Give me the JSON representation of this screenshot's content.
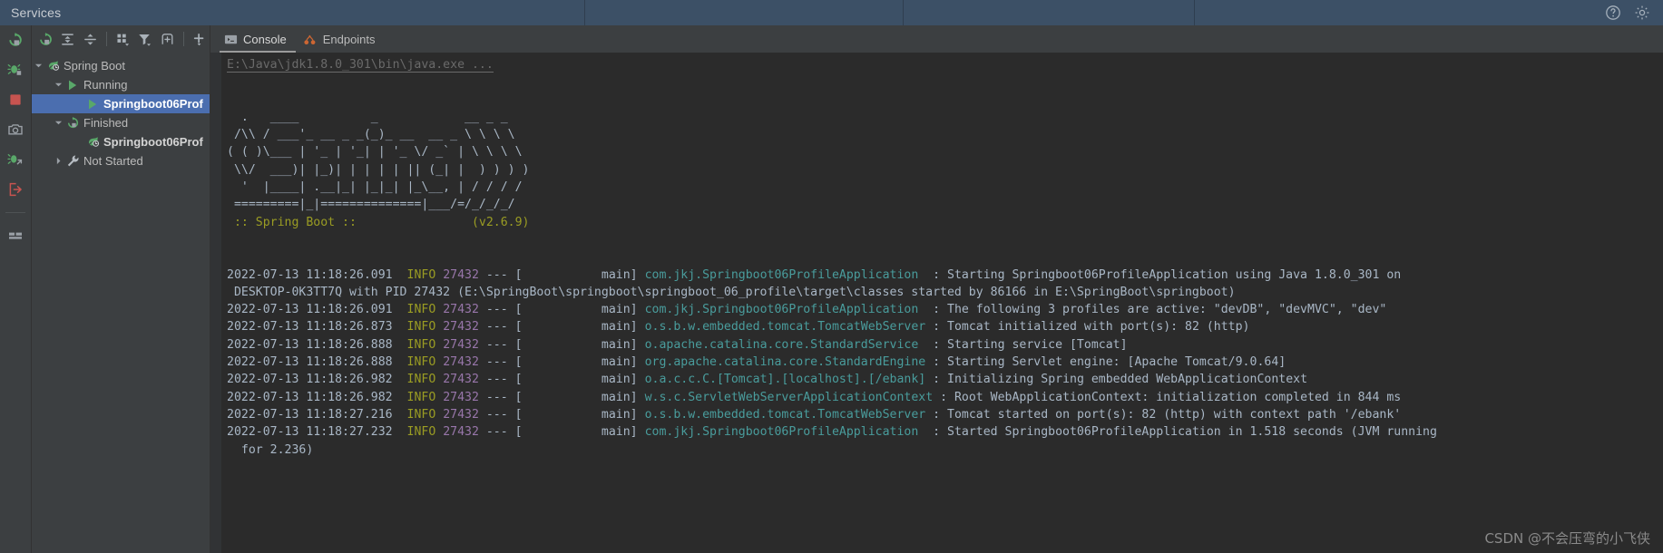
{
  "window": {
    "title": "Services",
    "right_icons": [
      {
        "name": "help-icon",
        "glyph": "?"
      },
      {
        "name": "settings-gear-icon",
        "glyph": "gear"
      }
    ]
  },
  "rail": {
    "items": [
      {
        "name": "rerun-icon",
        "tooltip": "Rerun"
      },
      {
        "name": "debug-icon",
        "tooltip": "Debug"
      },
      {
        "name": "stop-icon",
        "tooltip": "Stop"
      },
      {
        "name": "camera-icon",
        "tooltip": "Capture Memory Snapshot"
      },
      {
        "name": "debug-attach-icon",
        "tooltip": "Attach Debugger"
      },
      {
        "name": "exit-icon",
        "tooltip": "Exit"
      },
      {
        "name": "layout-icon",
        "tooltip": "Layout Settings"
      }
    ]
  },
  "services_toolbar": {
    "buttons": [
      {
        "name": "rerun-service-button",
        "tooltip": "Rerun"
      },
      {
        "name": "expand-all-button",
        "tooltip": "Expand All"
      },
      {
        "name": "collapse-all-button",
        "tooltip": "Collapse All"
      },
      {
        "name": "group-by-button",
        "tooltip": "Group By"
      },
      {
        "name": "filter-button",
        "tooltip": "Filter"
      },
      {
        "name": "show-frame-button",
        "tooltip": "Open in New Window"
      },
      {
        "name": "add-service-button",
        "tooltip": "Add Service"
      }
    ]
  },
  "services_tree": {
    "nodes": [
      {
        "label": "Spring Boot",
        "level": 0,
        "expanded": true,
        "icon": "spring-boot-icon",
        "bold": false,
        "selected": false
      },
      {
        "label": "Running",
        "level": 1,
        "expanded": true,
        "icon": "run-icon",
        "bold": false,
        "selected": false
      },
      {
        "label": "Springboot06Prof",
        "level": 2,
        "expanded": null,
        "icon": "run-icon",
        "bold": true,
        "selected": true
      },
      {
        "label": "Finished",
        "level": 1,
        "expanded": true,
        "icon": "rerun-icon",
        "bold": false,
        "selected": false
      },
      {
        "label": "Springboot06Prof",
        "level": 2,
        "expanded": null,
        "icon": "spring-boot-icon",
        "bold": true,
        "selected": false
      },
      {
        "label": "Not Started",
        "level": 1,
        "expanded": false,
        "icon": "wrench-icon",
        "bold": false,
        "selected": false
      }
    ]
  },
  "tabs": [
    {
      "label": "Console",
      "icon": "console-icon",
      "active": true
    },
    {
      "label": "Endpoints",
      "icon": "endpoints-icon",
      "active": false
    }
  ],
  "console": {
    "command_line": "E:\\Java\\jdk1.8.0_301\\bin\\java.exe ...",
    "banner_lines": [
      "  .   ____          _            __ _ _",
      " /\\\\ / ___'_ __ _ _(_)_ __  __ _ \\ \\ \\ \\",
      "( ( )\\___ | '_ | '_| | '_ \\/ _` | \\ \\ \\ \\",
      " \\\\/  ___)| |_)| | | | | || (_| |  ) ) ) )",
      "  '  |____| .__|_| |_|_| |_\\__, | / / / /",
      " =========|_|==============|___/=/_/_/_/"
    ],
    "spring_boot_version_line": " :: Spring Boot ::                (v2.6.9)",
    "log_entries": [
      {
        "timestamp": "2022-07-13 11:18:26.091",
        "level": "INFO",
        "pid": "27432",
        "separator": "---",
        "thread": "[           main]",
        "logger": "com.jkj.Springboot06ProfileApplication",
        "message": ": Starting Springboot06ProfileApplication using Java 1.8.0_301 on",
        "continuation": " DESKTOP-0K3TT7Q with PID 27432 (E:\\SpringBoot\\springboot\\springboot_06_profile\\target\\classes started by 86166 in E:\\SpringBoot\\springboot)"
      },
      {
        "timestamp": "2022-07-13 11:18:26.091",
        "level": "INFO",
        "pid": "27432",
        "separator": "---",
        "thread": "[           main]",
        "logger": "com.jkj.Springboot06ProfileApplication",
        "message": ": The following 3 profiles are active: \"devDB\", \"devMVC\", \"dev\"",
        "continuation": ""
      },
      {
        "timestamp": "2022-07-13 11:18:26.873",
        "level": "INFO",
        "pid": "27432",
        "separator": "---",
        "thread": "[           main]",
        "logger": "o.s.b.w.embedded.tomcat.TomcatWebServer",
        "message": ": Tomcat initialized with port(s): 82 (http)",
        "continuation": ""
      },
      {
        "timestamp": "2022-07-13 11:18:26.888",
        "level": "INFO",
        "pid": "27432",
        "separator": "---",
        "thread": "[           main]",
        "logger": "o.apache.catalina.core.StandardService",
        "message": ": Starting service [Tomcat]",
        "continuation": ""
      },
      {
        "timestamp": "2022-07-13 11:18:26.888",
        "level": "INFO",
        "pid": "27432",
        "separator": "---",
        "thread": "[           main]",
        "logger": "org.apache.catalina.core.StandardEngine",
        "message": ": Starting Servlet engine: [Apache Tomcat/9.0.64]",
        "continuation": ""
      },
      {
        "timestamp": "2022-07-13 11:18:26.982",
        "level": "INFO",
        "pid": "27432",
        "separator": "---",
        "thread": "[           main]",
        "logger": "o.a.c.c.C.[Tomcat].[localhost].[/ebank]",
        "message": ": Initializing Spring embedded WebApplicationContext",
        "continuation": ""
      },
      {
        "timestamp": "2022-07-13 11:18:26.982",
        "level": "INFO",
        "pid": "27432",
        "separator": "---",
        "thread": "[           main]",
        "logger": "w.s.c.ServletWebServerApplicationContext",
        "message": ": Root WebApplicationContext: initialization completed in 844 ms",
        "continuation": ""
      },
      {
        "timestamp": "2022-07-13 11:18:27.216",
        "level": "INFO",
        "pid": "27432",
        "separator": "---",
        "thread": "[           main]",
        "logger": "o.s.b.w.embedded.tomcat.TomcatWebServer",
        "message": ": Tomcat started on port(s): 82 (http) with context path '/ebank'",
        "continuation": ""
      },
      {
        "timestamp": "2022-07-13 11:18:27.232",
        "level": "INFO",
        "pid": "27432",
        "separator": "---",
        "thread": "[           main]",
        "logger": "com.jkj.Springboot06ProfileApplication",
        "message": ": Started Springboot06ProfileApplication in 1.518 seconds (JVM running",
        "continuation": "  for 2.236)"
      }
    ]
  },
  "watermark": "CSDN @不会压弯的小飞侠",
  "colors": {
    "titlebar_bg": "#3c5066",
    "panel_bg": "#3c3f41",
    "console_bg": "#2b2b2b",
    "selection_blue": "#4b6eaf",
    "log_level": "#9a9c23",
    "log_pid": "#9876aa",
    "log_logger": "#499c9c",
    "log_text": "#a9b7c6",
    "green_accent": "#59a869",
    "red_accent": "#c75450",
    "orange_accent": "#cc7832"
  }
}
